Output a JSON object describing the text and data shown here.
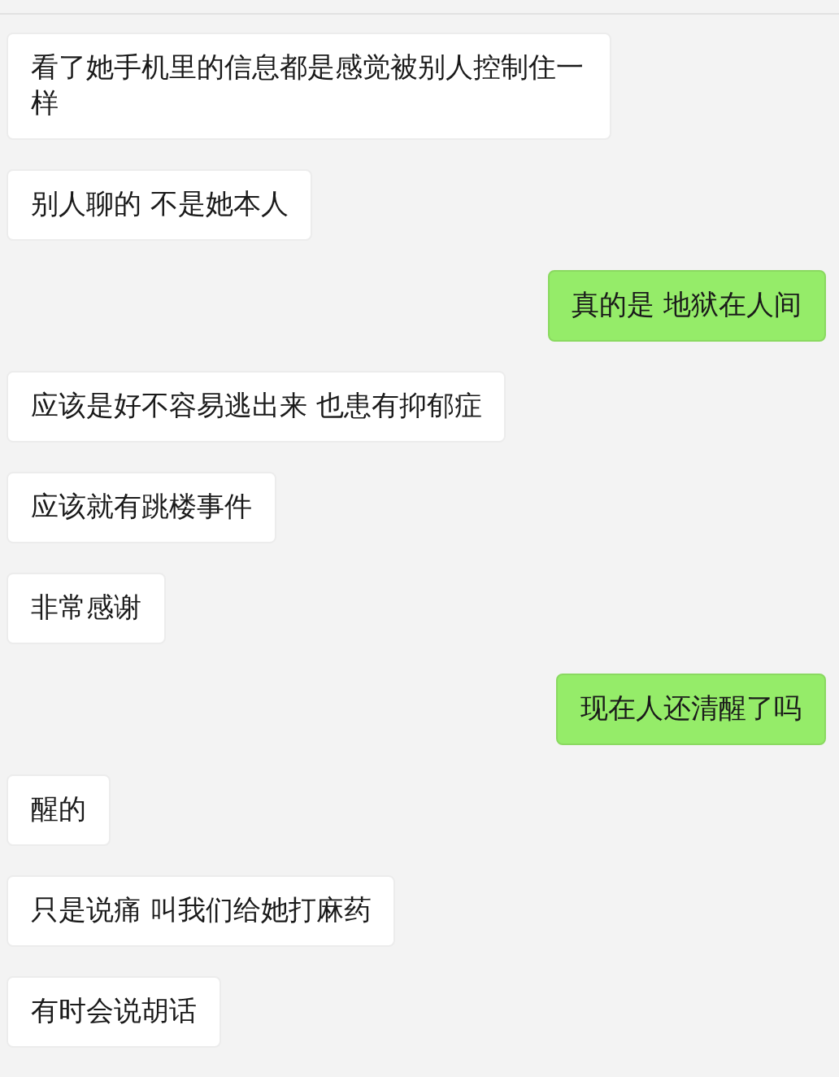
{
  "messages": [
    {
      "kind": "received",
      "text": "看了她手机里的信息都是感觉被别人控制住一样"
    },
    {
      "kind": "received",
      "text": "别人聊的 不是她本人"
    },
    {
      "kind": "sent",
      "text": "真的是 地狱在人间"
    },
    {
      "kind": "received",
      "text": "应该是好不容易逃出来 也患有抑郁症"
    },
    {
      "kind": "received",
      "text": "应该就有跳楼事件"
    },
    {
      "kind": "received",
      "text": "非常感谢"
    },
    {
      "kind": "sent",
      "text": "现在人还清醒了吗"
    },
    {
      "kind": "received",
      "text": "醒的"
    },
    {
      "kind": "received",
      "text": "只是说痛 叫我们给她打麻药"
    },
    {
      "kind": "received",
      "text": "有时会说胡话"
    }
  ]
}
